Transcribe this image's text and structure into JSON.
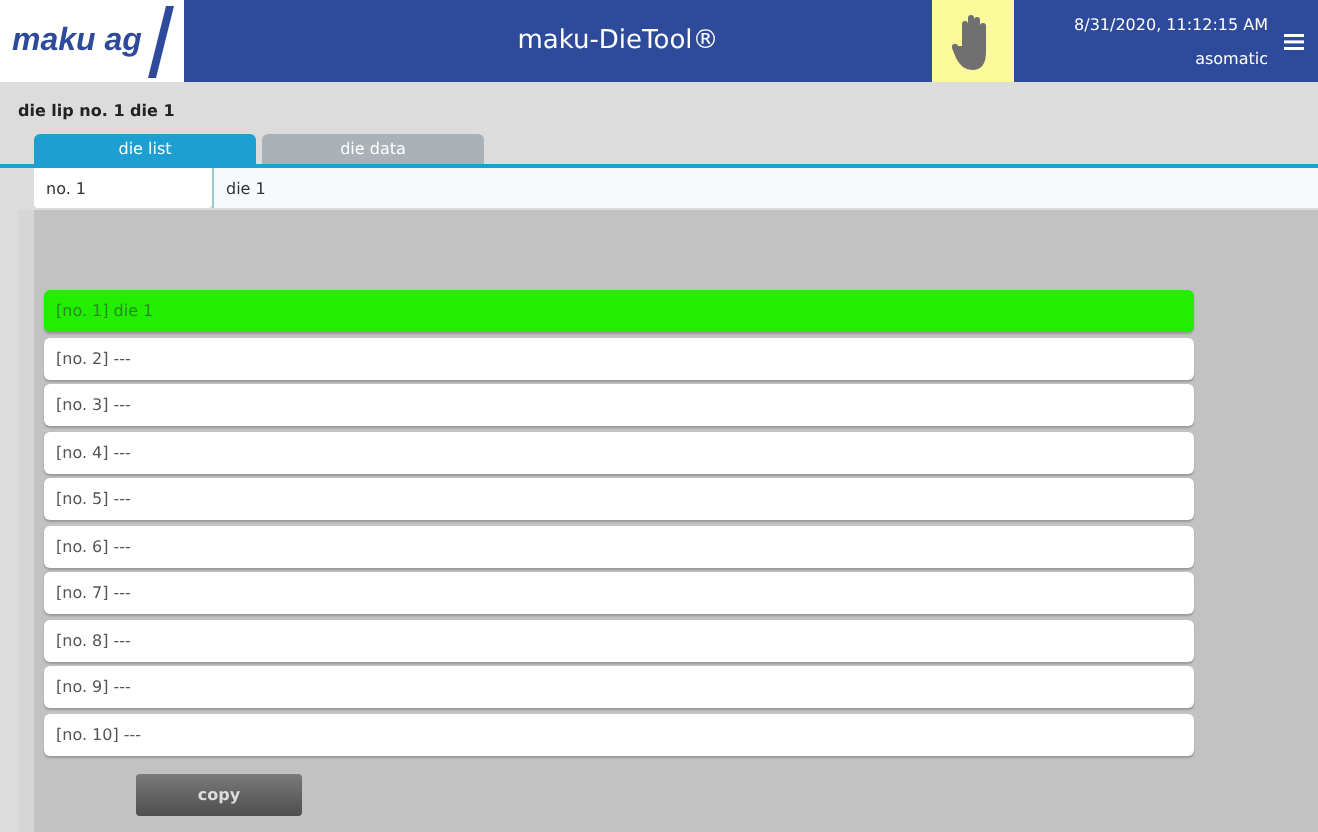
{
  "header": {
    "logo": "maku ag",
    "title": "maku-DieTool®",
    "datetime": "8/31/2020, 11:12:15 AM",
    "user": "asomatic"
  },
  "page_title": "die lip no. 1 die 1",
  "tabs": [
    {
      "label": "die list",
      "selected": true
    },
    {
      "label": "die data",
      "selected": false
    }
  ],
  "fields": {
    "number": "no. 1",
    "name": "die 1"
  },
  "dies": [
    {
      "label": "[no. 1] die 1",
      "selected": true
    },
    {
      "label": "[no. 2] ---",
      "selected": false
    },
    {
      "label": "[no. 3] ---",
      "selected": false
    },
    {
      "label": "[no. 4] ---",
      "selected": false
    },
    {
      "label": "[no. 5] ---",
      "selected": false
    },
    {
      "label": "[no. 6] ---",
      "selected": false
    },
    {
      "label": "[no. 7] ---",
      "selected": false
    },
    {
      "label": "[no. 8] ---",
      "selected": false
    },
    {
      "label": "[no. 9] ---",
      "selected": false
    },
    {
      "label": "[no. 10] ---",
      "selected": false
    }
  ],
  "buttons": [
    {
      "label": "copy"
    }
  ]
}
